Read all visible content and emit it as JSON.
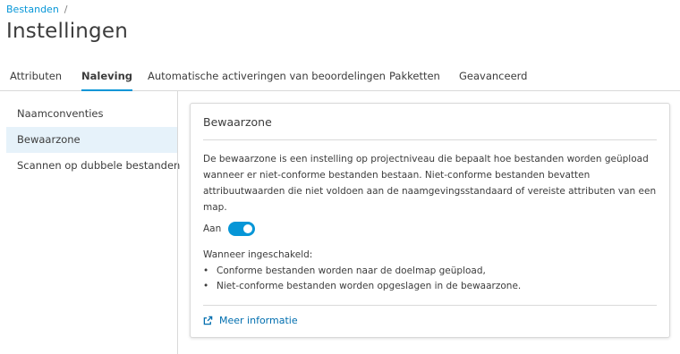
{
  "breadcrumb": {
    "link": "Bestanden",
    "separator": "/"
  },
  "page_title": "Instellingen",
  "tabs": [
    {
      "label": "Attributen",
      "active": false
    },
    {
      "label": "Naleving",
      "active": true
    },
    {
      "label": "Automatische activeringen van beoordelingen",
      "active": false
    },
    {
      "label": "Pakketten",
      "active": false
    },
    {
      "label": "Geavanceerd",
      "active": false
    }
  ],
  "sidebar": {
    "items": [
      {
        "label": "Naamconventies",
        "active": false
      },
      {
        "label": "Bewaarzone",
        "active": true
      },
      {
        "label": "Scannen op dubbele bestanden",
        "active": false
      }
    ]
  },
  "card": {
    "title": "Bewaarzone",
    "description": "De bewaarzone is een instelling op projectniveau die bepaalt hoe bestanden worden geüpload wanneer er niet-conforme bestanden bestaan. Niet-conforme bestanden bevatten attribuutwaarden die niet voldoen aan de naamgevingsstandaard of vereiste attributen van een map.",
    "toggle_label": "Aan",
    "toggle_on": true,
    "when_label": "Wanneer ingeschakeld:",
    "bullets": [
      "Conforme bestanden worden naar de doelmap geüpload,",
      "Niet-conforme bestanden worden opgeslagen in de bewaarzone."
    ],
    "bullet_glyph": "•",
    "more_link": "Meer informatie",
    "more_icon": "external-link-icon"
  },
  "colors": {
    "accent": "#0696d7",
    "link": "#006eaf",
    "active_bg": "#e6f2fa",
    "border": "#d9d9d9",
    "text": "#3c3c3c"
  }
}
